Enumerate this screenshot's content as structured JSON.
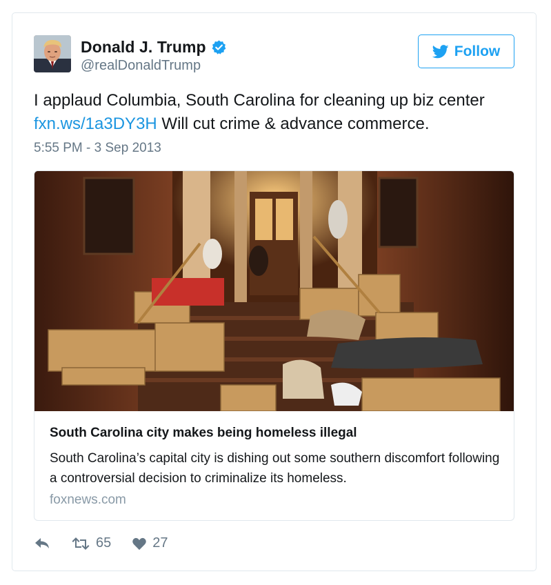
{
  "user": {
    "display_name": "Donald J. Trump",
    "handle": "@realDonaldTrump",
    "verified": true,
    "avatar_icon": "profile-photo"
  },
  "follow_button": {
    "label": "Follow",
    "icon": "twitter-bird-icon"
  },
  "tweet": {
    "text_before_link": "I applaud Columbia, South Carolina for cleaning up biz center ",
    "link_text": "fxn.ws/1a3DY3H",
    "text_after_link": " Will cut crime & advance commerce.",
    "timestamp": "5:55 PM - 3 Sep 2013"
  },
  "link_card": {
    "title": "South Carolina city makes being homeless illegal",
    "description": "South Carolina’s capital city is dishing out some southern discomfort following a controversial decision to criminalize its homeless.",
    "domain": "foxnews.com",
    "image_alt": "people sleeping on cardboard boxes on building steps at night"
  },
  "actions": {
    "reply_icon": "reply-icon",
    "retweet_icon": "retweet-icon",
    "retweet_count": "65",
    "like_icon": "heart-icon",
    "like_count": "27"
  },
  "colors": {
    "accent": "#1da1f2",
    "link": "#1b95e0",
    "secondary_text": "#657786",
    "border": "#e1e8ed"
  }
}
